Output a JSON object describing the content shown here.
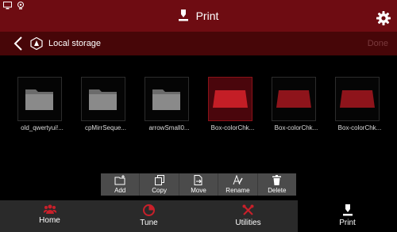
{
  "header": {
    "title": "Print",
    "status_icons": [
      "monitor-icon",
      "webcam-icon"
    ],
    "settings_icon": "gear-icon"
  },
  "subheader": {
    "back_icon": "back-chevron-icon",
    "storage_icon": "storage-logo-icon",
    "location": "Local storage",
    "done_label": "Done"
  },
  "files": [
    {
      "name": "old_qwertyui!...",
      "type": "folder"
    },
    {
      "name": "cpMirrSeque...",
      "type": "folder"
    },
    {
      "name": "arrowSmall0...",
      "type": "folder"
    },
    {
      "name": "Box-colorChk...",
      "type": "model",
      "selected": true
    },
    {
      "name": "Box-colorChk...",
      "type": "model"
    },
    {
      "name": "Box-colorChk...",
      "type": "model"
    }
  ],
  "actions": {
    "add": "Add",
    "copy": "Copy",
    "move": "Move",
    "rename": "Rename",
    "delete": "Delete"
  },
  "nav": {
    "home": "Home",
    "tune": "Tune",
    "utilities": "Utilities",
    "print": "Print",
    "active": "print"
  },
  "colors": {
    "header_bg": "#6e0c12",
    "subheader_bg": "#470608",
    "accent": "#c8202a",
    "selected_bg": "#4a060c"
  }
}
